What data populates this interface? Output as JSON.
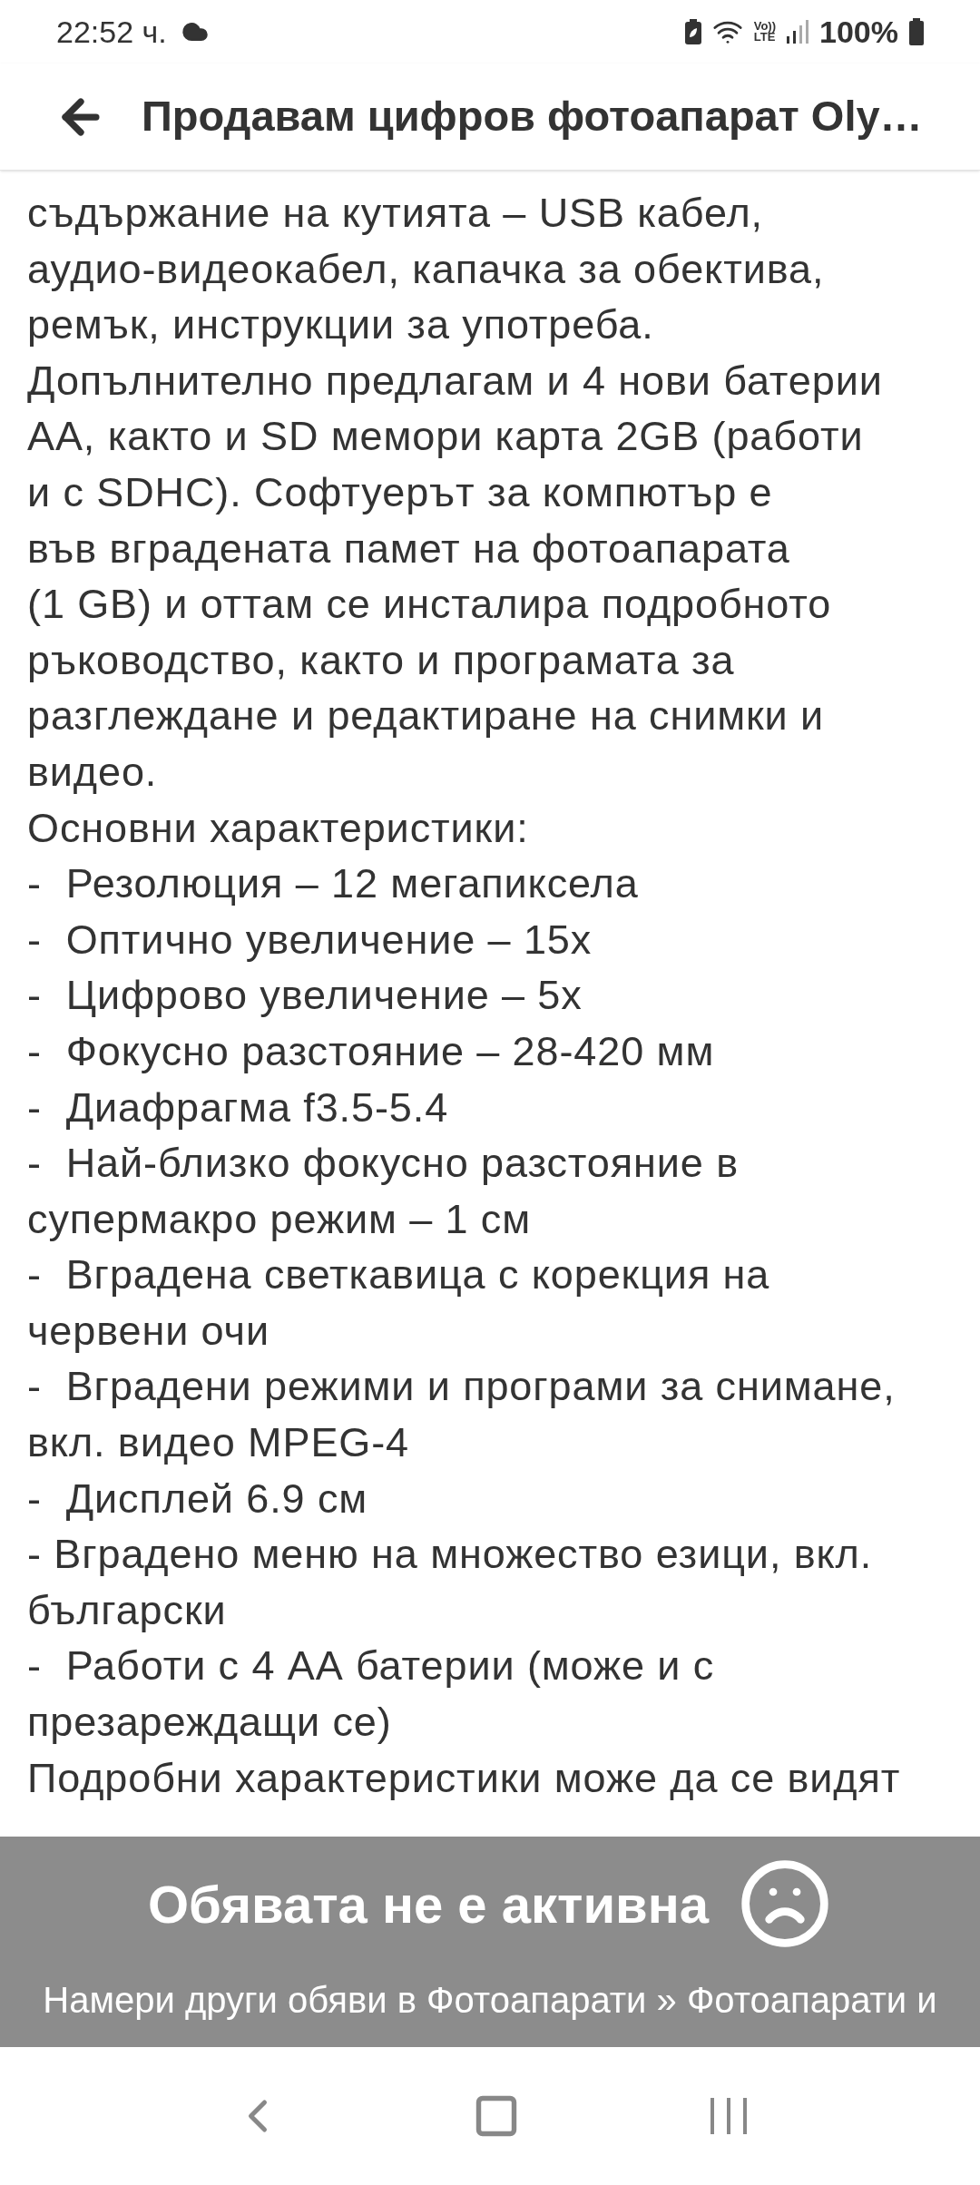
{
  "status_bar": {
    "time": "22:52 ч.",
    "volte_top": "Vo))",
    "volte_bottom": "LTE",
    "battery": "100%"
  },
  "header": {
    "title": "Продавам цифров фотоапарат Oly…"
  },
  "description": [
    {
      "text": "съдържание на кутията – USB кабел,\nаудио-видеокабел, капачка за обектива,\nремък, инструкции за употреба.\nДопълнително предлагам и 4 нови батерии\nАА, както и SD мемори карта 2GB (работи\nи с SDHC). Софтуерът за компютър е\nвъв вградената памет на фотоапарата\n(1 GB) и оттам се инсталира подробното\nръководство, както и програмата за\nразглеждане и редактиране на снимки и\nвидео."
    },
    {
      "text": "Основни характеристики:"
    },
    {
      "text": "-  Резолюция – 12 мегапиксела"
    },
    {
      "text": "-  Оптично увеличение – 15х"
    },
    {
      "text": "-  Цифрово увеличение – 5х"
    },
    {
      "text": "-  Фокусно разстояние – 28-420 мм"
    },
    {
      "text": "-  Диафрагма f3.5-5.4"
    },
    {
      "text": "-  Най-близко фокусно разстояние в\nсупермакро режим – 1 см"
    },
    {
      "text": "-  Вградена светкавица с корекция на\nчервени очи"
    },
    {
      "text": "-  Вградени режими и програми за снимане,\nвкл. видео MPEG-4"
    },
    {
      "text": "-  Дисплей 6.9 см"
    },
    {
      "text": "- Вградено меню на множество езици, вкл.\nбългарски"
    },
    {
      "text": "-  Работи с 4 АА батерии (може и с\nпрезареждащи се)"
    },
    {
      "text": "Подробни характеристики може да се видят"
    }
  ],
  "inactive_banner": {
    "title": "Обявата не е активна",
    "link": "Намери други обяви в Фотоапарати » Фотоапарати и"
  }
}
